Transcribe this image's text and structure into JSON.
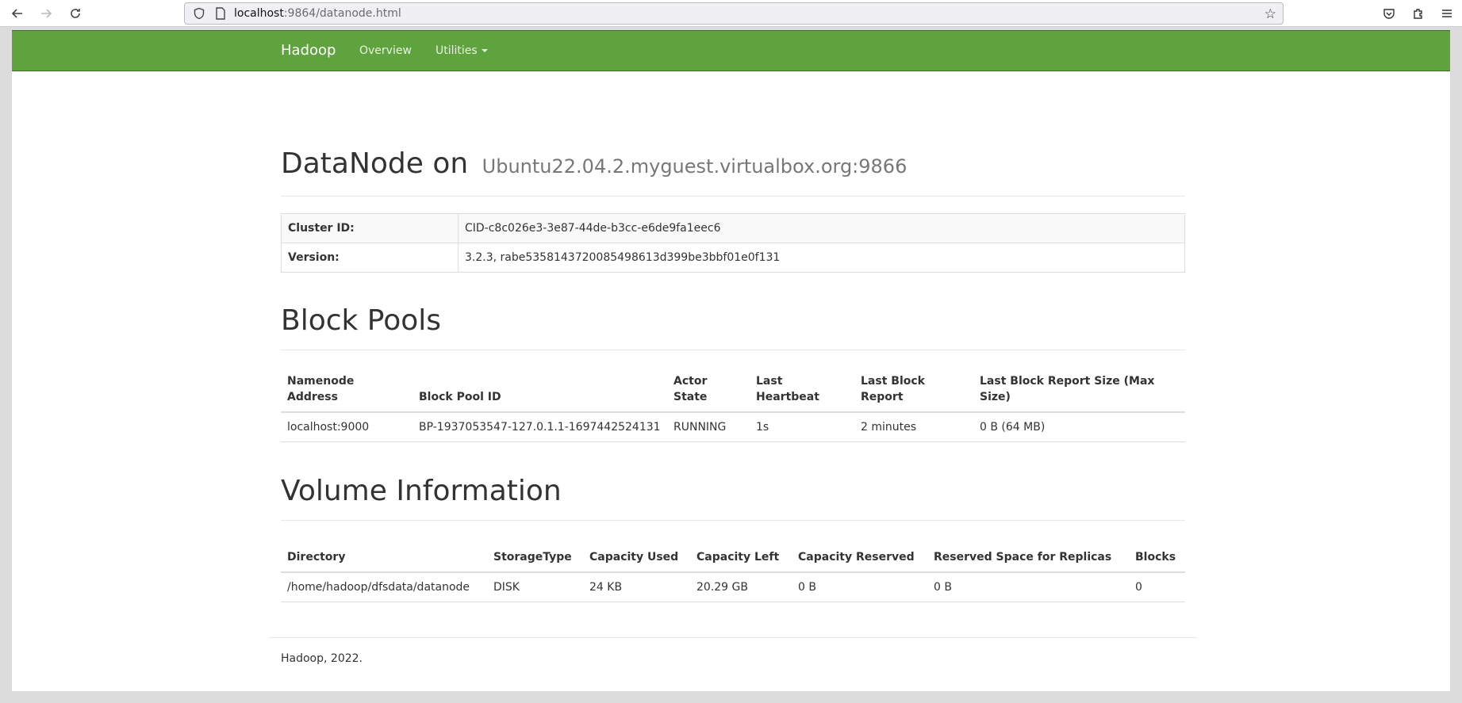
{
  "browser": {
    "url_host": "localhost",
    "url_rest": ":9864/datanode.html"
  },
  "navbar": {
    "brand": "Hadoop",
    "links": [
      {
        "label": "Overview"
      },
      {
        "label": "Utilities"
      }
    ]
  },
  "header": {
    "title": "DataNode on",
    "subtitle": "Ubuntu22.04.2.myguest.virtualbox.org:9866"
  },
  "info": {
    "rows": [
      {
        "key": "Cluster ID:",
        "value": "CID-c8c026e3-3e87-44de-b3cc-e6de9fa1eec6"
      },
      {
        "key": "Version:",
        "value": "3.2.3, rabe5358143720085498613d399be3bbf01e0f131"
      }
    ]
  },
  "block_pools": {
    "title": "Block Pools",
    "columns": [
      "Namenode Address",
      "Block Pool ID",
      "Actor State",
      "Last Heartbeat",
      "Last Block Report",
      "Last Block Report Size (Max Size)"
    ],
    "rows": [
      [
        "localhost:9000",
        "BP-1937053547-127.0.1.1-1697442524131",
        "RUNNING",
        "1s",
        "2 minutes",
        "0 B (64 MB)"
      ]
    ]
  },
  "volumes": {
    "title": "Volume Information",
    "columns": [
      "Directory",
      "StorageType",
      "Capacity Used",
      "Capacity Left",
      "Capacity Reserved",
      "Reserved Space for Replicas",
      "Blocks"
    ],
    "rows": [
      [
        "/home/hadoop/dfsdata/datanode",
        "DISK",
        "24 KB",
        "20.29 GB",
        "0 B",
        "0 B",
        "0"
      ]
    ]
  },
  "footer": {
    "text": "Hadoop, 2022."
  }
}
